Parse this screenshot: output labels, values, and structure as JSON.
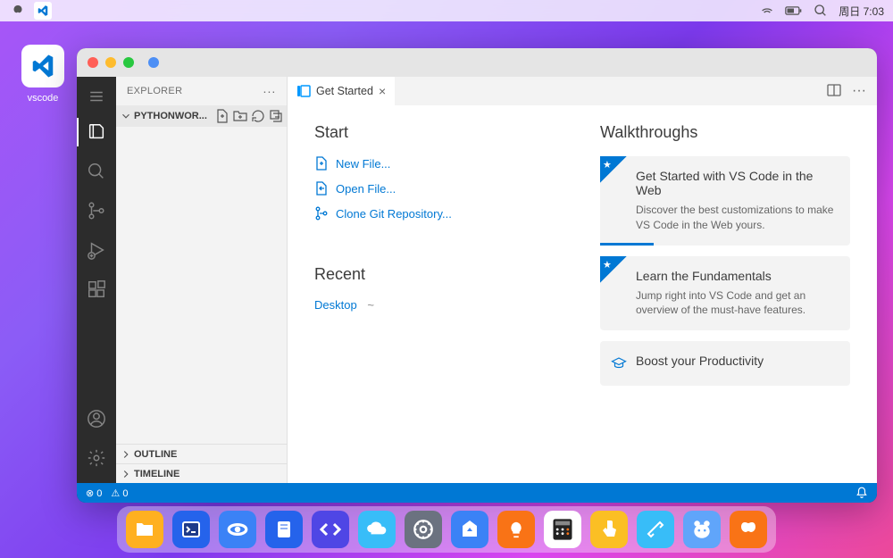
{
  "menubar": {
    "wifi": "wifi",
    "battery": "battery",
    "search": "search",
    "datetime": "周日 7:03"
  },
  "desktop": {
    "vscode_label": "vscode"
  },
  "vscode": {
    "sidebar": {
      "title": "EXPLORER",
      "folder_name": "PYTHONWOR...",
      "outline": "OUTLINE",
      "timeline": "TIMELINE"
    },
    "tab": {
      "label": "Get Started"
    },
    "start": {
      "heading": "Start",
      "new_file": "New File...",
      "open_file": "Open File...",
      "clone_repo": "Clone Git Repository..."
    },
    "recent": {
      "heading": "Recent",
      "item": "Desktop",
      "path": "~"
    },
    "walkthroughs": {
      "heading": "Walkthroughs",
      "cards": [
        {
          "title": "Get Started with VS Code in the Web",
          "desc": "Discover the best customizations to make VS Code in the Web yours."
        },
        {
          "title": "Learn the Fundamentals",
          "desc": "Jump right into VS Code and get an overview of the must-have features."
        },
        {
          "title": "Boost your Productivity",
          "desc": ""
        }
      ]
    },
    "statusbar": {
      "errors": "0",
      "warnings": "0"
    }
  }
}
